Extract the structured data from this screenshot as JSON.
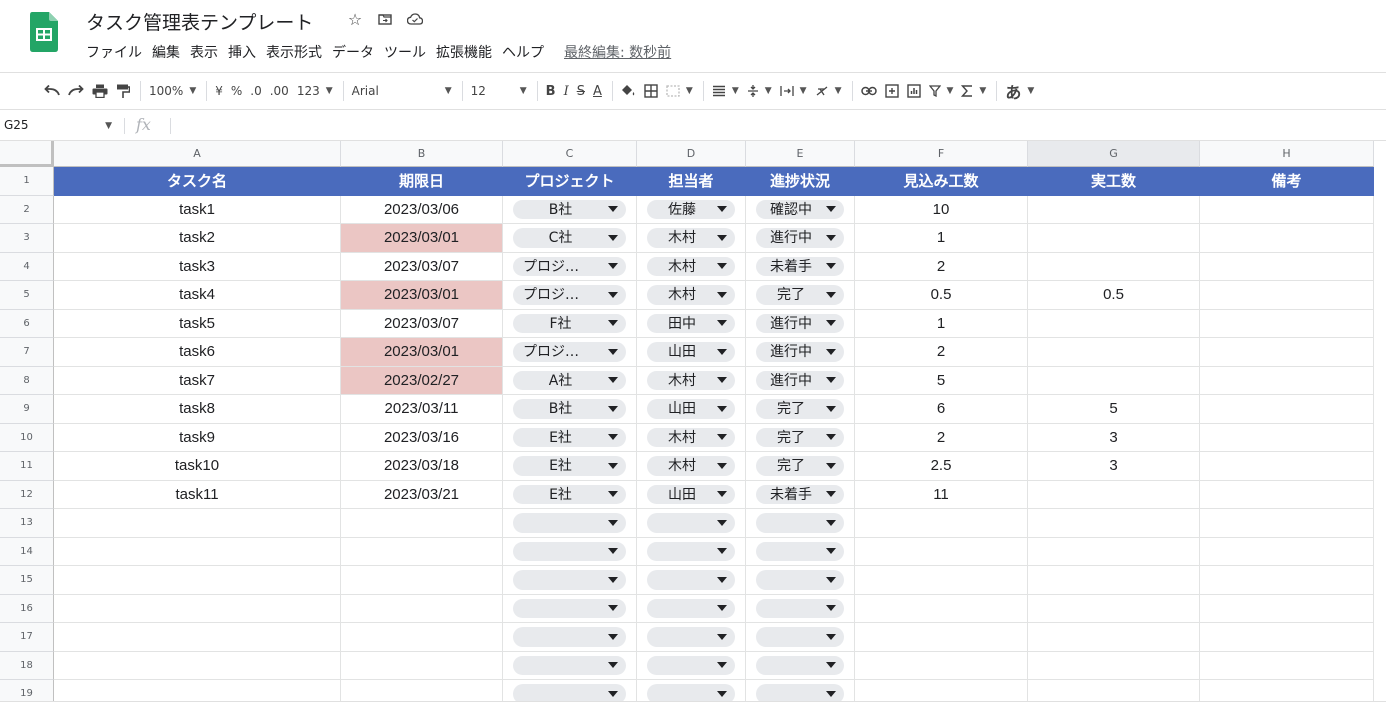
{
  "app": {
    "title": "タスク管理表テンプレート",
    "menu": [
      "ファイル",
      "編集",
      "表示",
      "挿入",
      "表示形式",
      "データ",
      "ツール",
      "拡張機能",
      "ヘルプ"
    ],
    "last_edit": "最終編集: 数秒前",
    "title_icons": [
      "star-icon",
      "move-to-folder-icon",
      "cloud-status-icon"
    ]
  },
  "toolbar": {
    "zoom": "100%",
    "currency": "¥",
    "percent": "%",
    "decrease_decimal": ".0",
    "increase_decimal": ".00",
    "more_formats": "123",
    "font": "Arial",
    "font_size": "12",
    "bold": "B",
    "italic": "I",
    "strikethrough": "S",
    "text_color": "A",
    "input_tools": "あ"
  },
  "formula": {
    "cell_ref": "G25",
    "fx": "fx"
  },
  "sheet": {
    "selected_column": "G",
    "columns": [
      "A",
      "B",
      "C",
      "D",
      "E",
      "F",
      "G",
      "H"
    ],
    "header_row": [
      "タスク名",
      "期限日",
      "プロジェクト",
      "担当者",
      "進捗状況",
      "見込み工数",
      "実工数",
      "備考"
    ],
    "rows": [
      {
        "num": "2",
        "task": "task1",
        "due": "2023/03/06",
        "overdue": false,
        "project": "B社",
        "owner": "佐藤",
        "status": "確認中",
        "est": "10",
        "actual": "",
        "note": ""
      },
      {
        "num": "3",
        "task": "task2",
        "due": "2023/03/01",
        "overdue": true,
        "project": "C社",
        "owner": "木村",
        "status": "進行中",
        "est": "1",
        "actual": "",
        "note": ""
      },
      {
        "num": "4",
        "task": "task3",
        "due": "2023/03/07",
        "overdue": false,
        "project": "プロジ…",
        "owner": "木村",
        "status": "未着手",
        "est": "2",
        "actual": "",
        "note": ""
      },
      {
        "num": "5",
        "task": "task4",
        "due": "2023/03/01",
        "overdue": true,
        "project": "プロジ…",
        "owner": "木村",
        "status": "完了",
        "est": "0.5",
        "actual": "0.5",
        "note": ""
      },
      {
        "num": "6",
        "task": "task5",
        "due": "2023/03/07",
        "overdue": false,
        "project": "F社",
        "owner": "田中",
        "status": "進行中",
        "est": "1",
        "actual": "",
        "note": ""
      },
      {
        "num": "7",
        "task": "task6",
        "due": "2023/03/01",
        "overdue": true,
        "project": "プロジ…",
        "owner": "山田",
        "status": "進行中",
        "est": "2",
        "actual": "",
        "note": ""
      },
      {
        "num": "8",
        "task": "task7",
        "due": "2023/02/27",
        "overdue": true,
        "project": "A社",
        "owner": "木村",
        "status": "進行中",
        "est": "5",
        "actual": "",
        "note": ""
      },
      {
        "num": "9",
        "task": "task8",
        "due": "2023/03/11",
        "overdue": false,
        "project": "B社",
        "owner": "山田",
        "status": "完了",
        "est": "6",
        "actual": "5",
        "note": ""
      },
      {
        "num": "10",
        "task": "task9",
        "due": "2023/03/16",
        "overdue": false,
        "project": "E社",
        "owner": "木村",
        "status": "完了",
        "est": "2",
        "actual": "3",
        "note": ""
      },
      {
        "num": "11",
        "task": "task10",
        "due": "2023/03/18",
        "overdue": false,
        "project": "E社",
        "owner": "木村",
        "status": "完了",
        "est": "2.5",
        "actual": "3",
        "note": ""
      },
      {
        "num": "12",
        "task": "task11",
        "due": "2023/03/21",
        "overdue": false,
        "project": "E社",
        "owner": "山田",
        "status": "未着手",
        "est": "11",
        "actual": "",
        "note": ""
      }
    ],
    "empty_rows": [
      "13",
      "14",
      "15",
      "16",
      "17",
      "18",
      "19"
    ],
    "colors": {
      "header_bg": "#4a6bbd",
      "overdue_bg": "#ebc6c4",
      "chip_bg": "#e8eaed"
    }
  }
}
